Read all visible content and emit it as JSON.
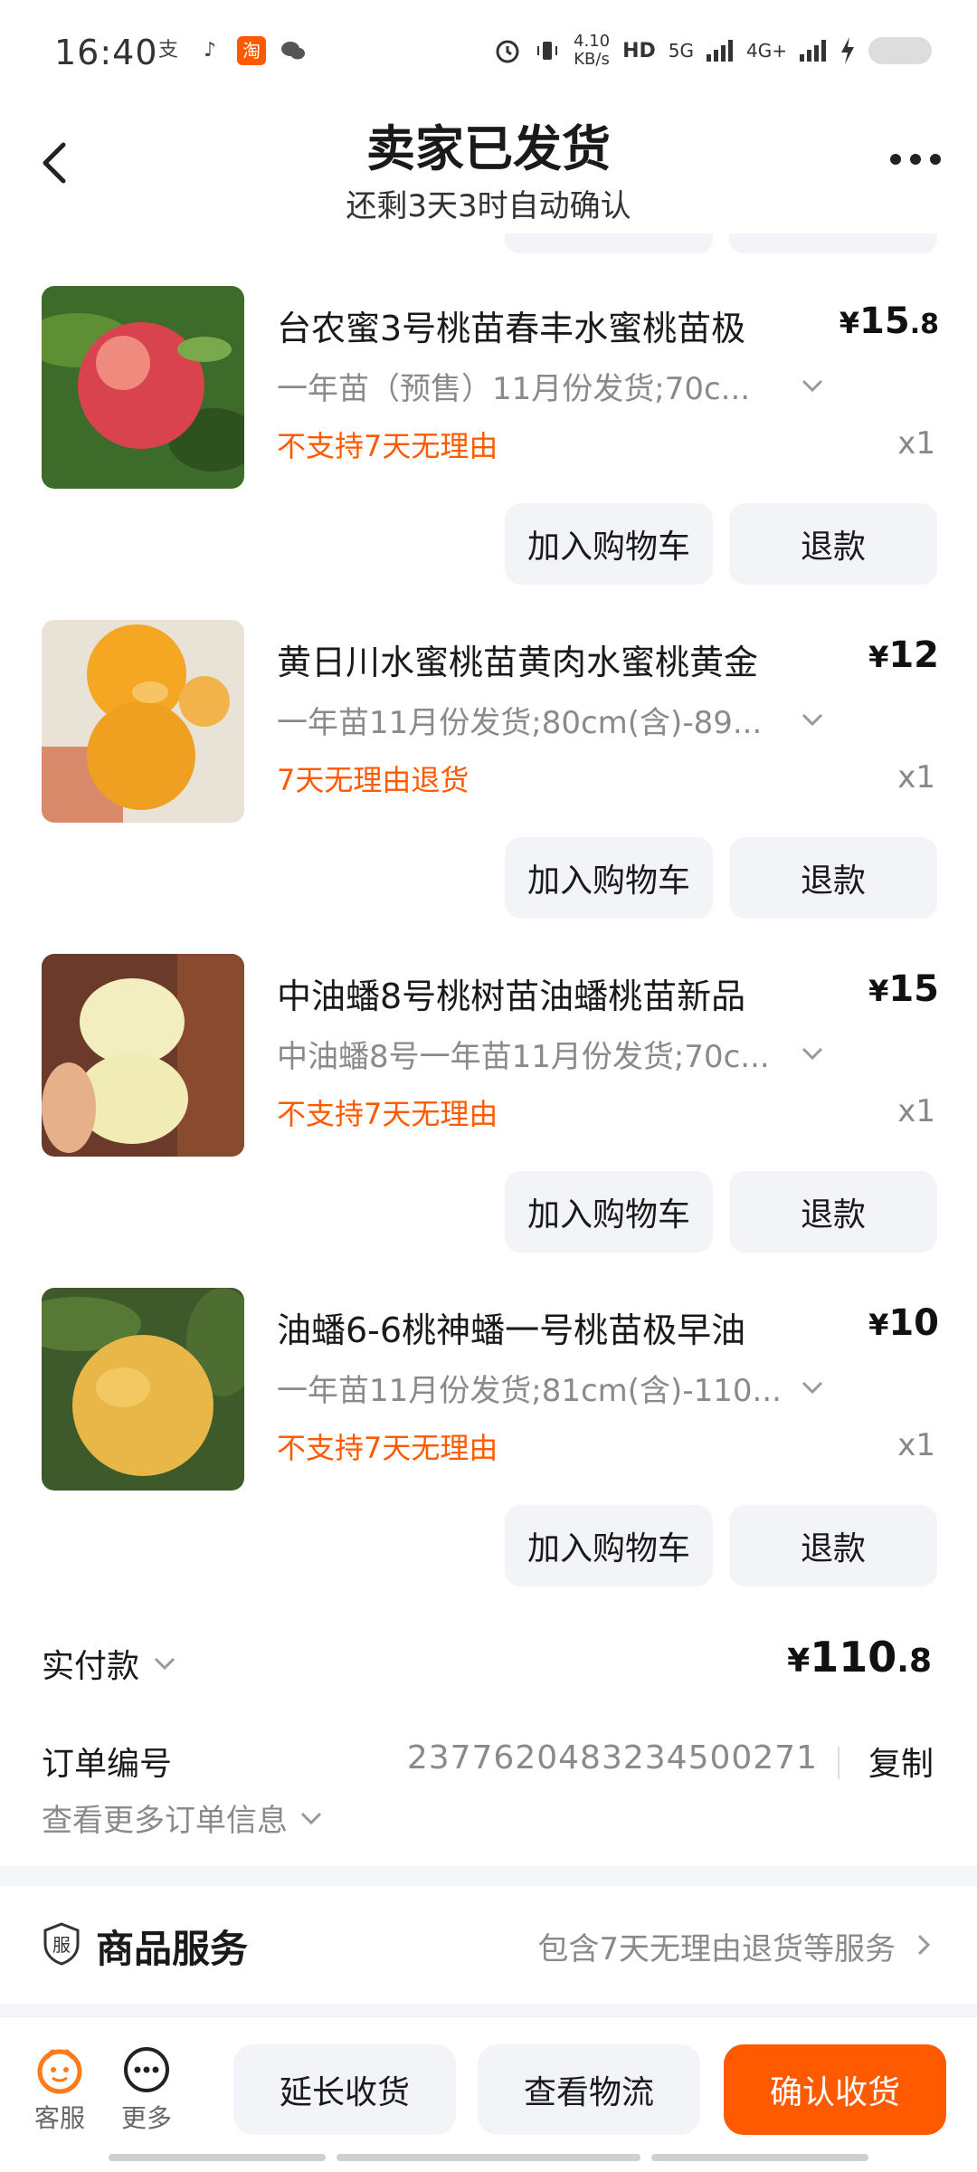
{
  "status_bar": {
    "time": "16:40",
    "left_icons": [
      "alipay-icon",
      "tiktok-icon",
      "taobao-icon",
      "wechat-icon"
    ],
    "taobao_glyph": "淘",
    "net_speed_value": "4.10",
    "net_speed_unit": "KB/s",
    "signal_labels": [
      "HD",
      "5G",
      "4G+"
    ]
  },
  "header": {
    "title": "卖家已发货",
    "subtitle": "还剩3天3时自动确认"
  },
  "products": [
    {
      "title": "台农蜜3号桃苗春丰水蜜桃苗极",
      "price_int": "15",
      "price_dec": ".8",
      "spec": "一年苗（预售）11月份发货;70c...",
      "tag": "不支持7天无理由",
      "qty": "x1",
      "cart_label": "加入购物车",
      "refund_label": "退款"
    },
    {
      "title": "黄日川水蜜桃苗黄肉水蜜桃黄金",
      "price_int": "12",
      "price_dec": "",
      "spec": "一年苗11月份发货;80cm(含)-89...",
      "tag": "7天无理由退货",
      "qty": "x1",
      "cart_label": "加入购物车",
      "refund_label": "退款"
    },
    {
      "title": "中油蟠8号桃树苗油蟠桃苗新品",
      "price_int": "15",
      "price_dec": "",
      "spec": "中油蟠8号一年苗11月份发货;70c...",
      "tag": "不支持7天无理由",
      "qty": "x1",
      "cart_label": "加入购物车",
      "refund_label": "退款"
    },
    {
      "title": "油蟠6-6桃神蟠一号桃苗极早油",
      "price_int": "10",
      "price_dec": "",
      "spec": "一年苗11月份发货;81cm(含)-110...",
      "tag": "不支持7天无理由",
      "qty": "x1",
      "cart_label": "加入购物车",
      "refund_label": "退款"
    }
  ],
  "currency": "¥",
  "payment": {
    "label": "实付款",
    "amount_int": "110",
    "amount_dec": ".8"
  },
  "order": {
    "label": "订单编号",
    "number": "2377620483234500271",
    "copy_label": "复制",
    "more_info_label": "查看更多订单信息"
  },
  "service": {
    "icon_glyph": "服",
    "title": "商品服务",
    "desc": "包含7天无理由退货等服务"
  },
  "bottom_bar": {
    "customer_service_label": "客服",
    "more_label": "更多",
    "extend_label": "延长收货",
    "logistics_label": "查看物流",
    "confirm_label": "确认收货"
  },
  "colors": {
    "accent": "#ff5a00",
    "button_bg": "#f2f4f7",
    "muted_text": "#8a8a8a"
  }
}
